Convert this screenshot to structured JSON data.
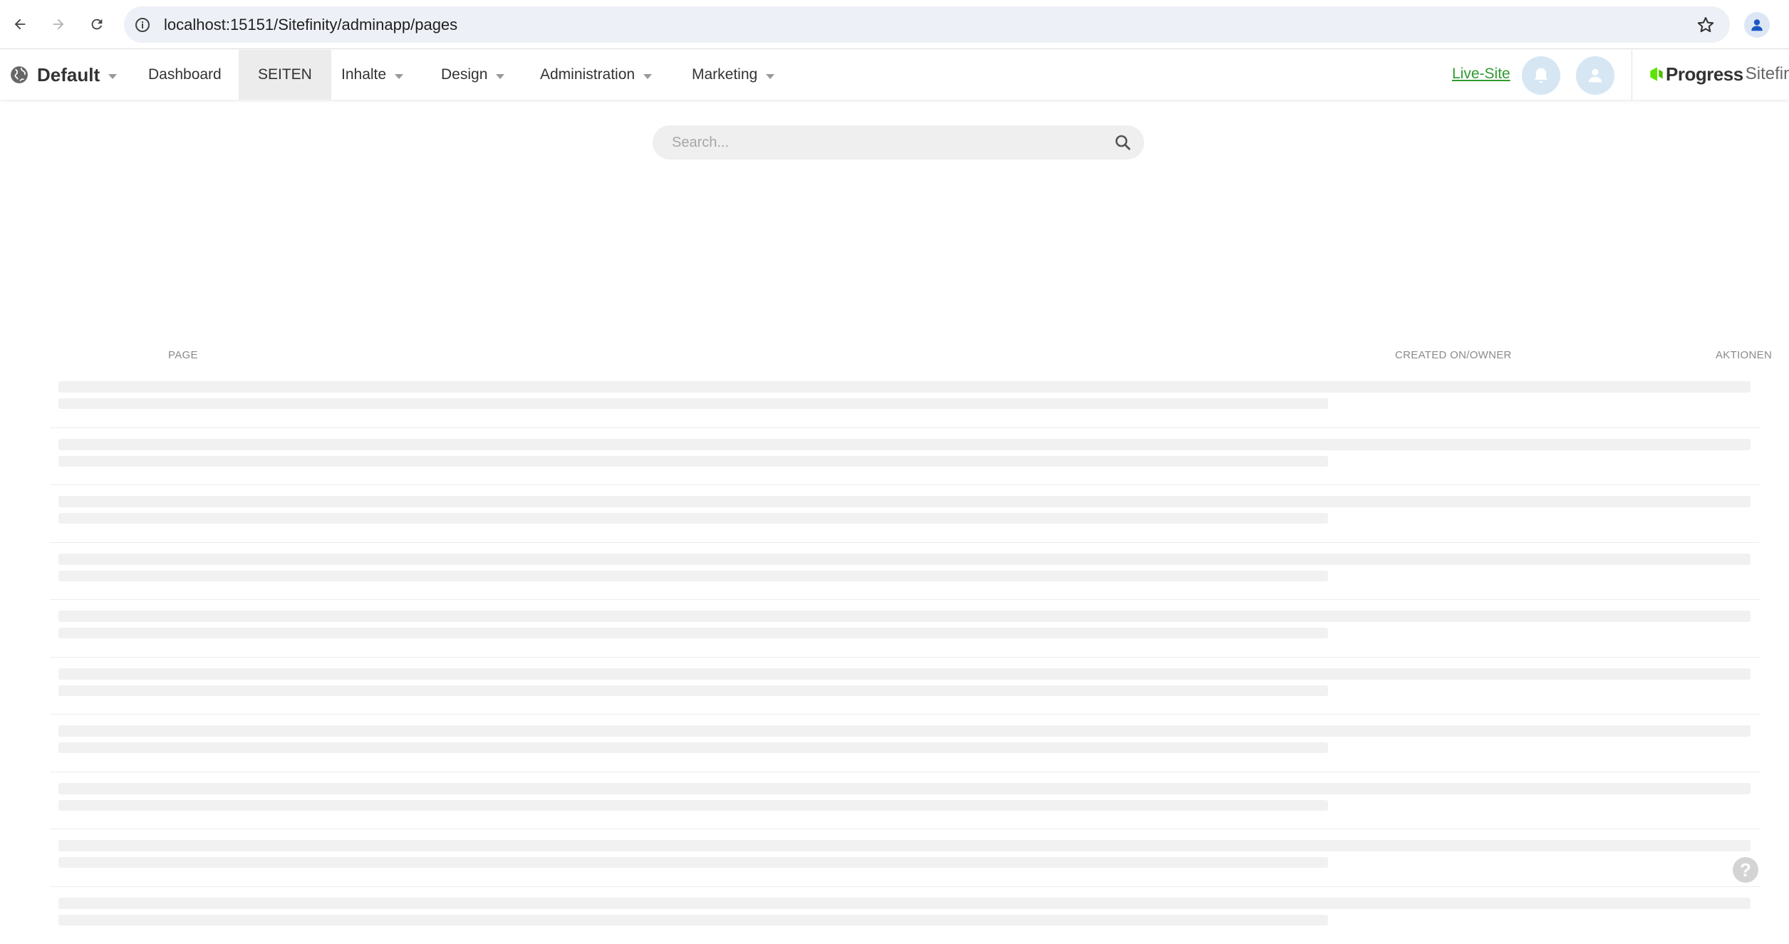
{
  "browser": {
    "url": "localhost:15151/Sitefinity/adminapp/pages"
  },
  "header": {
    "site_name": "Default",
    "nav": [
      {
        "label": "Dashboard",
        "has_menu": false,
        "active": false
      },
      {
        "label": "SEITEN",
        "has_menu": false,
        "active": true
      },
      {
        "label": "Inhalte",
        "has_menu": true,
        "active": false
      },
      {
        "label": "Design",
        "has_menu": true,
        "active": false
      },
      {
        "label": "Administration",
        "has_menu": true,
        "active": false
      },
      {
        "label": "Marketing",
        "has_menu": true,
        "active": false
      }
    ],
    "live_site_label": "Live-Site",
    "brand_progress": "Progress",
    "brand_sitefinity": "Sitefinity",
    "link_color": "#2f9a2f"
  },
  "search": {
    "placeholder": "Search..."
  },
  "table": {
    "columns": {
      "page": "PAGE",
      "created": "CREATED ON/OWNER",
      "actions": "AKTIONEN"
    },
    "loading": true,
    "placeholder_rows": 10
  },
  "help_label": "?"
}
